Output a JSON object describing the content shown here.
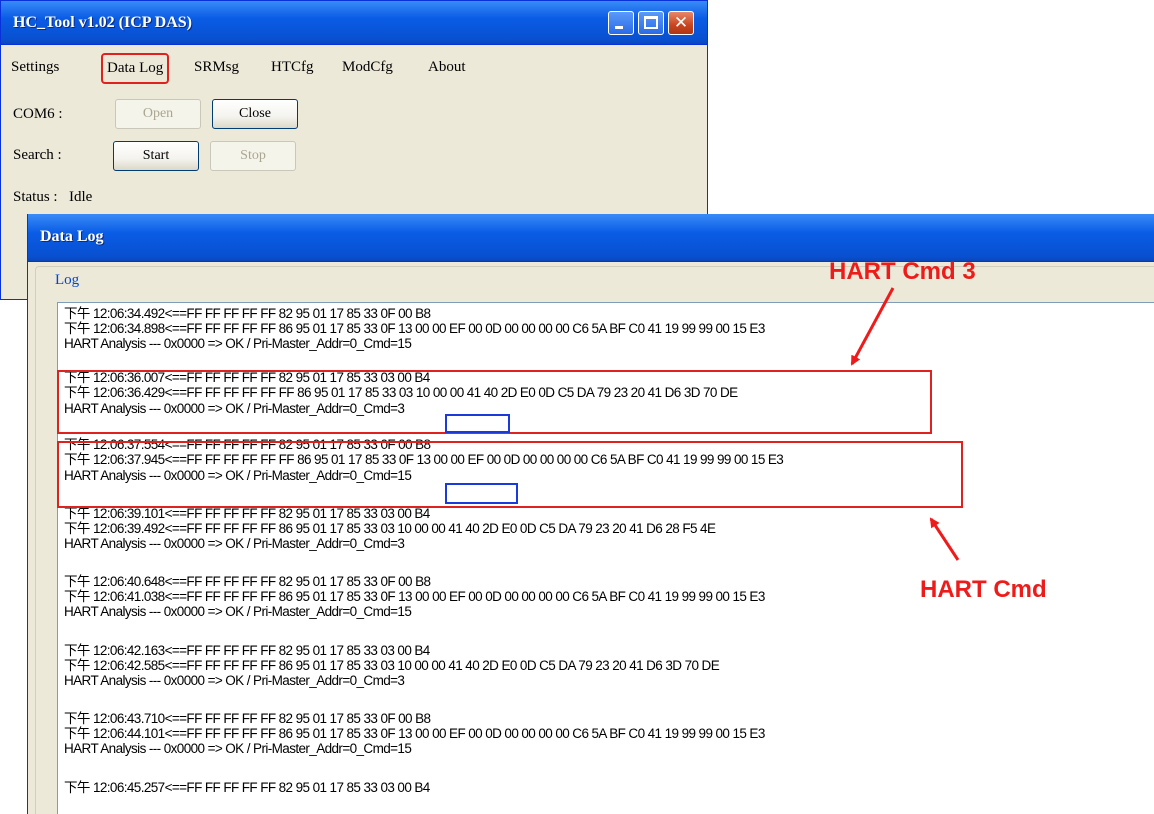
{
  "main_window": {
    "title": "HC_Tool v1.02  (ICP DAS)",
    "menu": [
      "Settings",
      "Data Log",
      "SRMsg",
      "HTCfg",
      "ModCfg",
      "About"
    ],
    "com_label": "COM6 :",
    "open_label": "Open",
    "close_label": "Close",
    "search_label": "Search :",
    "start_label": "Start",
    "stop_label": "Stop",
    "status_label": "Status :",
    "status_value": "Idle"
  },
  "datalog_window": {
    "title": "Data Log",
    "group_label": "Log",
    "lines": [
      "下午 12:06:34.492<==FF FF FF FF FF 82 95 01 17 85 33 0F 00 B8",
      "下午 12:06:34.898<==FF FF FF FF FF 86 95 01 17 85 33 0F 13 00 00 EF 00 0D 00 00 00 00 C6 5A BF C0 41 19 99 99 00 15 E3",
      "HART Analysis --- 0x0000 => OK / Pri-Master_Addr=0_Cmd=15",
      "下午 12:06:36.007<==FF FF FF FF FF 82 95 01 17 85 33 03 00 B4",
      "下午 12:06:36.429<==FF FF FF FF FF FF 86 95 01 17 85 33 03 10 00 00 41 40 2D E0 0D C5 DA 79 23 20 41 D6 3D 70 DE",
      "HART Analysis --- 0x0000 => OK / Pri-Master_Addr=0_Cmd=3",
      "下午 12:06:37.554<==FF FF FF FF FF 82 95 01 17 85 33 0F 00 B8",
      "下午 12:06:37.945<==FF FF FF FF FF FF 86 95 01 17 85 33 0F 13 00 00 EF 00 0D 00 00 00 00 C6 5A BF C0 41 19 99 99 00 15 E3",
      "HART Analysis --- 0x0000 => OK / Pri-Master_Addr=0_Cmd=15",
      "下午 12:06:39.101<==FF FF FF FF FF 82 95 01 17 85 33 03 00 B4",
      "下午 12:06:39.492<==FF FF FF FF FF 86 95 01 17 85 33 03 10 00 00 41 40 2D E0 0D C5 DA 79 23 20 41 D6 28 F5 4E",
      "HART Analysis --- 0x0000 => OK / Pri-Master_Addr=0_Cmd=3",
      "下午 12:06:40.648<==FF FF FF FF FF 82 95 01 17 85 33 0F 00 B8",
      "下午 12:06:41.038<==FF FF FF FF FF 86 95 01 17 85 33 0F 13 00 00 EF 00 0D 00 00 00 00 C6 5A BF C0 41 19 99 99 00 15 E3",
      "HART Analysis --- 0x0000 => OK / Pri-Master_Addr=0_Cmd=15",
      "下午 12:06:42.163<==FF FF FF FF FF 82 95 01 17 85 33 03 00 B4",
      "下午 12:06:42.585<==FF FF FF FF FF 86 95 01 17 85 33 03 10 00 00 41 40 2D E0 0D C5 DA 79 23 20 41 D6 3D 70 DE",
      "HART Analysis --- 0x0000 => OK / Pri-Master_Addr=0_Cmd=3",
      "下午 12:06:43.710<==FF FF FF FF FF 82 95 01 17 85 33 0F 00 B8",
      "下午 12:06:44.101<==FF FF FF FF FF 86 95 01 17 85 33 0F 13 00 00 EF 00 0D 00 00 00 00 C6 5A BF C0 41 19 99 99 00 15 E3",
      "HART Analysis --- 0x0000 => OK / Pri-Master_Addr=0_Cmd=15",
      "下午 12:06:45.257<==FF FF FF FF FF 82 95 01 17 85 33 03 00 B4"
    ]
  },
  "annotations": {
    "label_cmd3": "HART Cmd 3",
    "label_cmd": "HART Cmd",
    "color": "#ee1b1b"
  }
}
